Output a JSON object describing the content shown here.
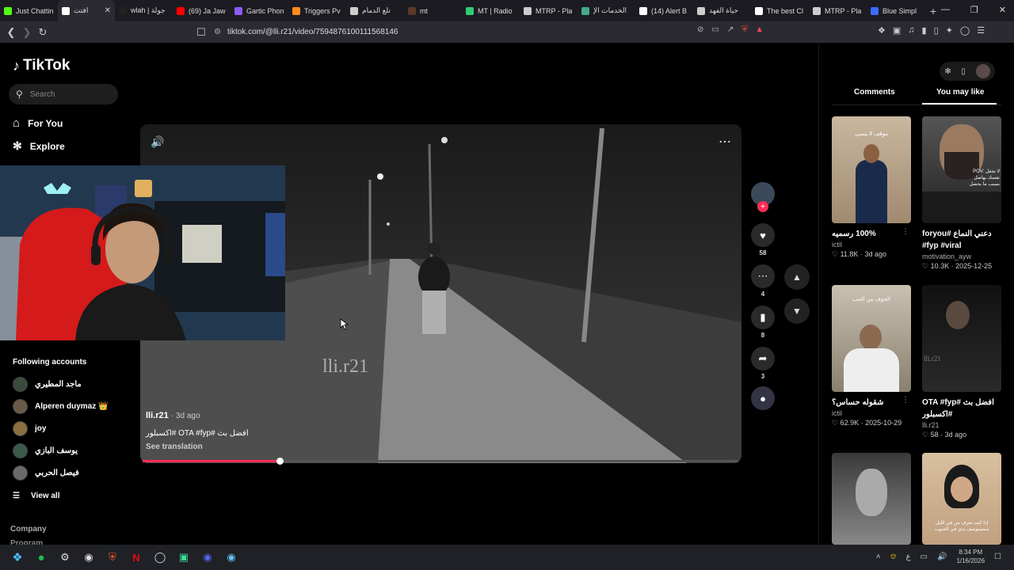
{
  "browser": {
    "tabs": [
      {
        "label": "Just Chattin",
        "color": "#53fc18"
      },
      {
        "label": "افتت",
        "color": "#ffffff",
        "active": true
      },
      {
        "label": "wlah | جولة",
        "color": "#222222"
      },
      {
        "label": "(69) Ja Jaw",
        "color": "#ff0000"
      },
      {
        "label": "Gartic Phon",
        "color": "#8a5cf5"
      },
      {
        "label": "Triggers Pv",
        "color": "#ff8c1a"
      },
      {
        "label": "تلع الدمام",
        "color": "#cccccc"
      },
      {
        "label": "mt",
        "color": "#5b3a29"
      },
      {
        "label": "MT | Radio",
        "color": "#2ecc71"
      },
      {
        "label": "MTRP - Pla",
        "color": "#cccccc"
      },
      {
        "label": "الخدمات الإ",
        "color": "#44aa88"
      },
      {
        "label": "(14) Alert B",
        "color": "#ffffff"
      },
      {
        "label": "حياة الفهد",
        "color": "#cccccc"
      },
      {
        "label": "The best Cl",
        "color": "#ffffff"
      },
      {
        "label": "MTRP - Pla",
        "color": "#cccccc"
      },
      {
        "label": "Blue Simpl",
        "color": "#3a6bff"
      }
    ],
    "new_tab": "+",
    "url": "tiktok.com/@lli.r21/video/7594876100111568146"
  },
  "sidebar": {
    "logo": "TikTok",
    "search_placeholder": "Search",
    "nav": [
      {
        "label": "For You",
        "icon": "home-icon"
      },
      {
        "label": "Explore",
        "icon": "compass-icon"
      }
    ],
    "following_title": "Following accounts",
    "following": [
      {
        "name": "ماجد المطيري"
      },
      {
        "name": "Alperen duymaz 👑"
      },
      {
        "name": "joy"
      },
      {
        "name": "يوسف البازي"
      },
      {
        "name": "فيصل الحربي"
      }
    ],
    "view_all": "View all",
    "company": "Company",
    "program": "Program"
  },
  "video": {
    "watermark": "lli.r21",
    "author": "lli.r21",
    "age": "· 3d ago",
    "caption": "افضل بث #OTA #fyp #اكسبلور",
    "see_translation": "See translation",
    "progress": 0.23
  },
  "actions": {
    "likes": "58",
    "comments": "4",
    "saves": "8",
    "shares": "3"
  },
  "right_panel": {
    "tabs": [
      "Comments",
      "You may like"
    ],
    "active_tab": "You may like",
    "cards": [
      {
        "title": "100% رسميه",
        "author": "ictil",
        "likes": "11.8K",
        "date": "3d ago",
        "thumb_text": "موقف لا ينسى"
      },
      {
        "title": "دعني النماع #foryou #fyp #viral",
        "author": "motivation_ayw",
        "likes": "10.3K",
        "date": "2025-12-25",
        "thumb_text": "POV: لا تجعل نفسك بهاصل بسبب ما يحصل"
      },
      {
        "title": "شقوله حساس؟",
        "author": "ictil",
        "likes": "62.9K",
        "date": "2025-10-29",
        "thumb_text": "الخوف من الحب"
      },
      {
        "title": "افضل بث #OTA #fyp #اكسبلور",
        "author": "lli.r21",
        "likes": "58",
        "date": "3d ago",
        "thumb_text": "lli.r21"
      },
      {
        "title": "",
        "author": "",
        "likes": "",
        "date": "",
        "thumb_text": ""
      },
      {
        "title": "",
        "author": "",
        "likes": "",
        "date": "",
        "thumb_text": "إذا كنت تعرف من في الليل ستستوصف بدي في الجنوب"
      }
    ]
  },
  "taskbar": {
    "time": "8:34 PM",
    "date": "1/16/2026"
  }
}
